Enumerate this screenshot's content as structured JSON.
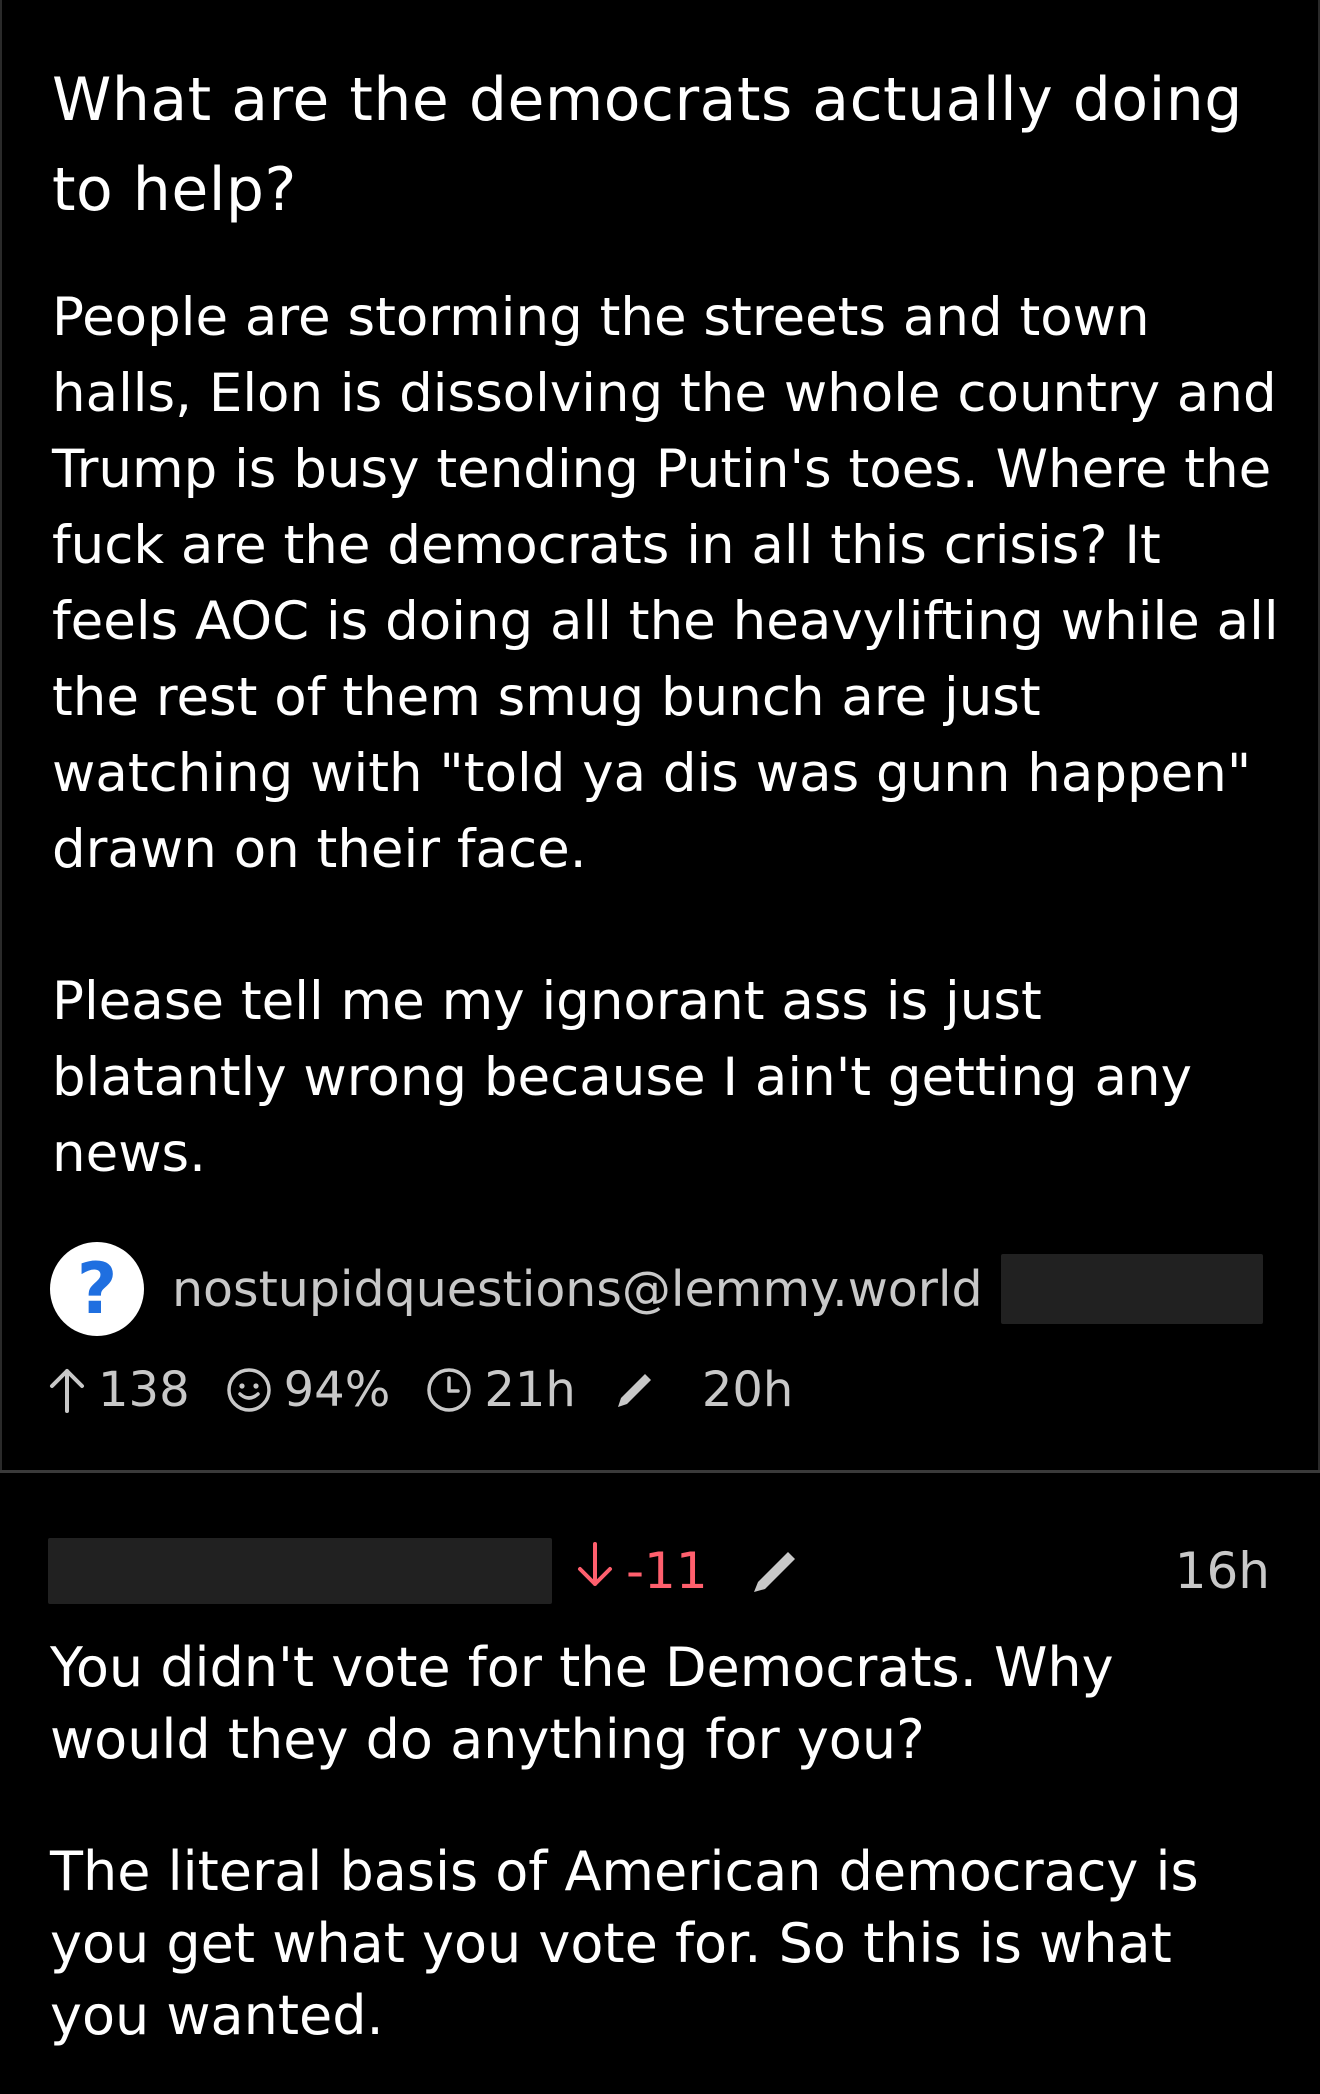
{
  "post": {
    "title": "What are the democrats actually doing to help?",
    "body": [
      "People are storming the streets and town halls, Elon is dissolving the whole country and Trump is busy tending Putin's toes. Where the fuck are the democrats in all this crisis? It feels AOC is doing all the heavylifting while all the rest of them smug bunch are just watching with \"told ya dis was gunn happen\" drawn on their face.",
      "Please tell me my ignorant ass is just blatantly wrong because I ain't getting any news."
    ],
    "community": {
      "avatar_glyph": "?",
      "name": "nostupidquestions@lemmy.world"
    },
    "stats": {
      "upvotes": "138",
      "upvote_ratio": "94%",
      "posted_ago": "21h",
      "edited_ago": "20h"
    }
  },
  "comment": {
    "score": "-11",
    "time_ago": "16h",
    "body": [
      "You didn't vote for the Democrats. Why would they do anything for you?",
      "The literal basis of American democracy is you get what you vote for. So this is what you wanted."
    ]
  },
  "icons": {
    "upvote": "arrow-up-icon",
    "ratio": "smiley-icon",
    "time": "clock-icon",
    "edited": "pencil-icon",
    "downvote": "arrow-down-icon"
  },
  "colors": {
    "background": "#000000",
    "text": "#ffffff",
    "muted": "#c8c8c8",
    "downvote": "#ff5f6d",
    "redaction": "#212121",
    "community_icon": "#1f6fe0"
  }
}
